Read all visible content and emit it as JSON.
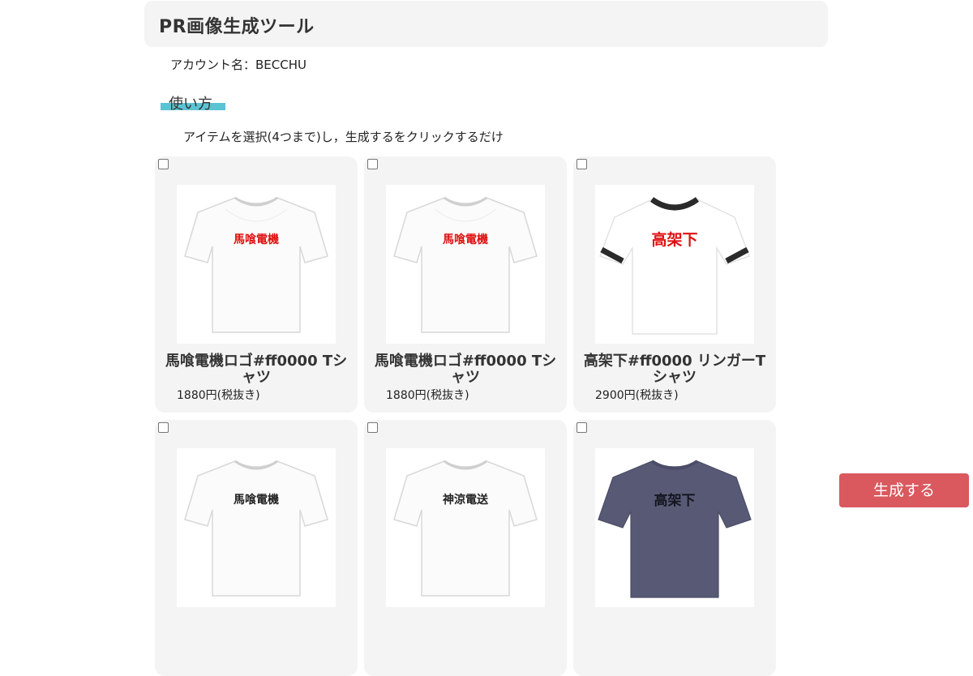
{
  "header": {
    "title": "PR画像生成ツール"
  },
  "account": {
    "label": "アカウント名：BECCHU"
  },
  "usage": {
    "heading": "使い方",
    "instruction": "アイテムを選択(4つまで)し，生成するをクリックするだけ"
  },
  "colors": {
    "accent": "#5bc4d3",
    "button": "#d9595e",
    "card_bg": "#f4f4f4",
    "print_red": "#e01010"
  },
  "items": [
    {
      "name": "馬喰電機ロゴ#ff0000 Tシャツ",
      "price": "1880円(税抜き)",
      "print": "馬喰電機",
      "checked": false
    },
    {
      "name": "馬喰電機ロゴ#ff0000 Tシャツ",
      "price": "1880円(税抜き)",
      "print": "馬喰電機",
      "checked": false
    },
    {
      "name": "高架下#ff0000 リンガーTシャツ",
      "price": "2900円(税抜き)",
      "print": "高架下",
      "checked": false
    },
    {
      "name": "",
      "price": "",
      "print": "馬喰電機",
      "checked": false
    },
    {
      "name": "",
      "price": "",
      "print": "神涼電送",
      "checked": false
    },
    {
      "name": "",
      "price": "",
      "print": "高架下",
      "checked": false
    }
  ],
  "generate_button": {
    "label": "生成する"
  }
}
